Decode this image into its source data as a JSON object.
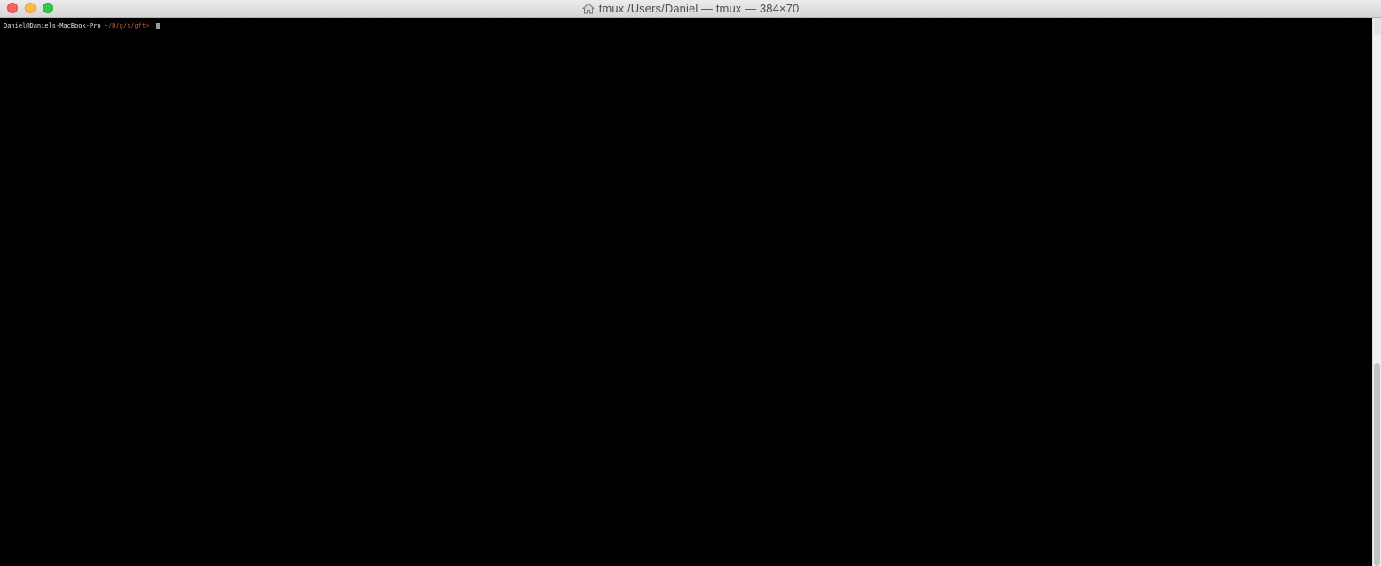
{
  "window": {
    "title": "tmux  /Users/Daniel — tmux — 384×70",
    "title_icon": "home-icon"
  },
  "terminal": {
    "prompt_user_host": "Daniel@Daniels-MacBook-Pro",
    "prompt_path": "~/D/g/s/gft>"
  },
  "scrollbar": {
    "position_fraction": 0.63,
    "thumb_fraction": 0.37
  },
  "colors": {
    "background": "#000000",
    "prompt_user": "#e8e8e8",
    "prompt_path": "#d0562e",
    "titlebar": "#e6e6e6"
  }
}
